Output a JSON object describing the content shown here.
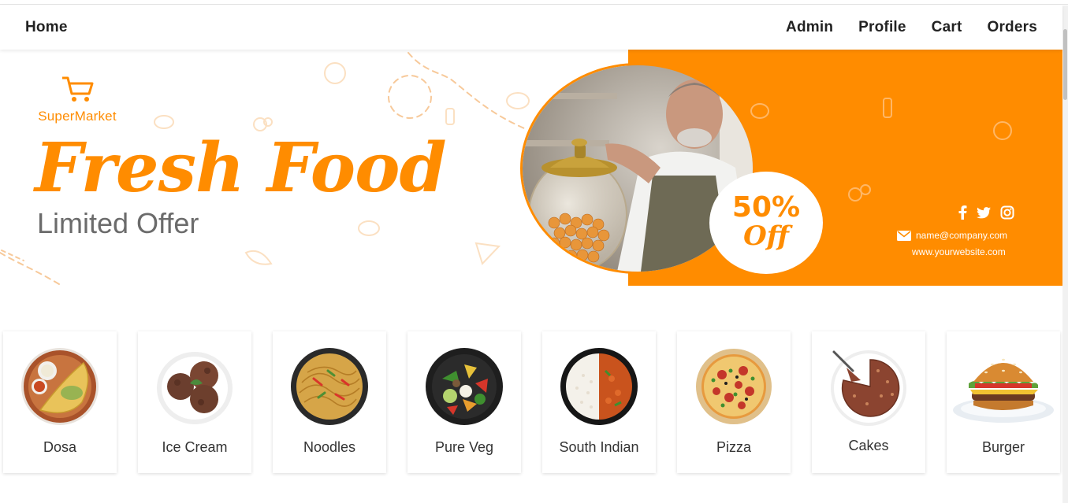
{
  "nav": {
    "home": "Home",
    "links": [
      "Admin",
      "Profile",
      "Cart",
      "Orders"
    ]
  },
  "banner": {
    "logo_text": "SuperMarket",
    "headline": "Fresh Food",
    "subline": "Limited Offer",
    "offer_percent": "50%",
    "offer_word": "Off",
    "email": "name@company.com",
    "website": "www.yourwebsite.com",
    "accent_color": "#ff8c00",
    "social_icons": [
      "facebook-icon",
      "twitter-icon",
      "instagram-icon"
    ]
  },
  "categories": [
    {
      "label": "Dosa",
      "icon": "dosa"
    },
    {
      "label": "Ice Cream",
      "icon": "ice-cream"
    },
    {
      "label": "Noodles",
      "icon": "noodles"
    },
    {
      "label": "Pure Veg",
      "icon": "pure-veg"
    },
    {
      "label": "South Indian",
      "icon": "south-indian"
    },
    {
      "label": "Pizza",
      "icon": "pizza"
    },
    {
      "label": "Cakes",
      "icon": "cakes"
    },
    {
      "label": "Burger",
      "icon": "burger"
    }
  ]
}
